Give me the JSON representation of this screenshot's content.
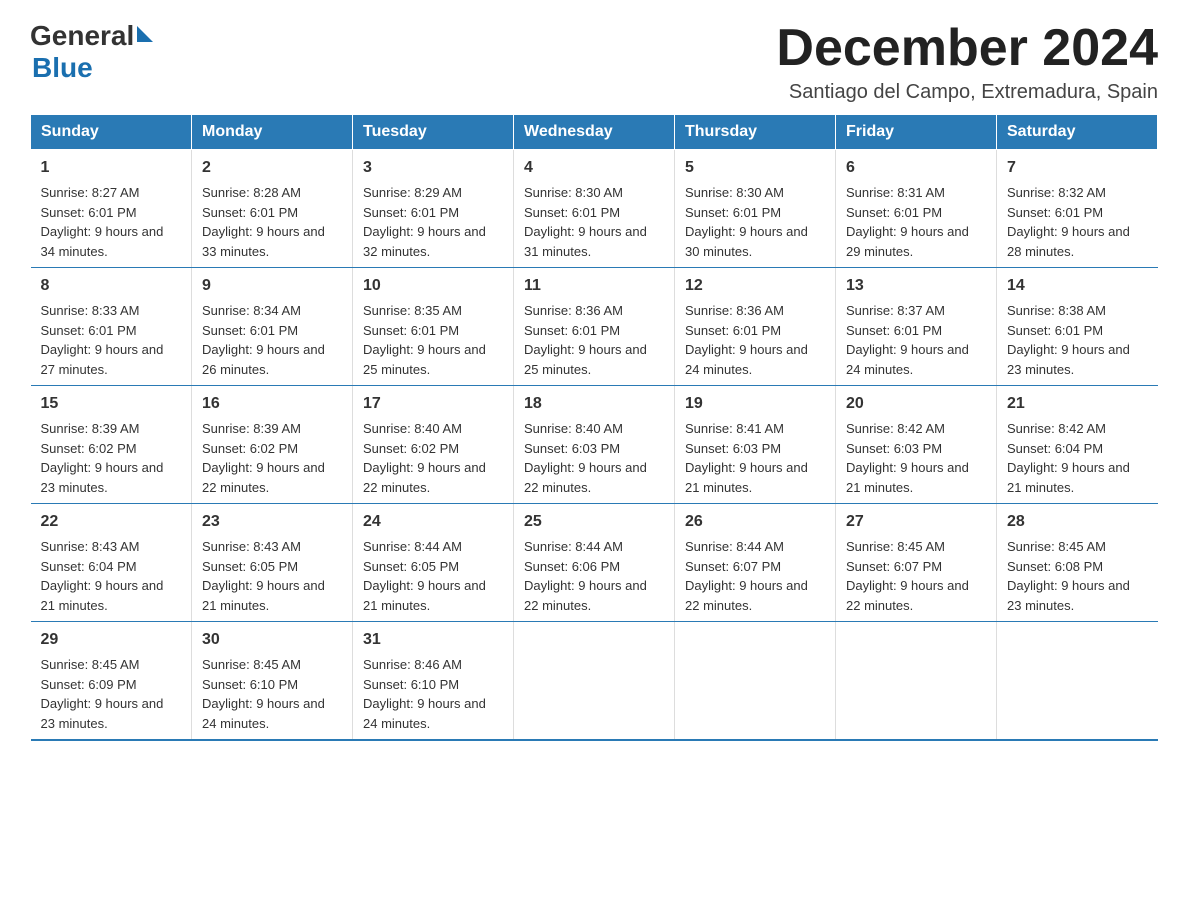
{
  "logo": {
    "general": "General",
    "blue": "Blue"
  },
  "header": {
    "title": "December 2024",
    "subtitle": "Santiago del Campo, Extremadura, Spain"
  },
  "calendar": {
    "days": [
      "Sunday",
      "Monday",
      "Tuesday",
      "Wednesday",
      "Thursday",
      "Friday",
      "Saturday"
    ],
    "weeks": [
      [
        {
          "date": "1",
          "sunrise": "8:27 AM",
          "sunset": "6:01 PM",
          "daylight": "9 hours and 34 minutes."
        },
        {
          "date": "2",
          "sunrise": "8:28 AM",
          "sunset": "6:01 PM",
          "daylight": "9 hours and 33 minutes."
        },
        {
          "date": "3",
          "sunrise": "8:29 AM",
          "sunset": "6:01 PM",
          "daylight": "9 hours and 32 minutes."
        },
        {
          "date": "4",
          "sunrise": "8:30 AM",
          "sunset": "6:01 PM",
          "daylight": "9 hours and 31 minutes."
        },
        {
          "date": "5",
          "sunrise": "8:30 AM",
          "sunset": "6:01 PM",
          "daylight": "9 hours and 30 minutes."
        },
        {
          "date": "6",
          "sunrise": "8:31 AM",
          "sunset": "6:01 PM",
          "daylight": "9 hours and 29 minutes."
        },
        {
          "date": "7",
          "sunrise": "8:32 AM",
          "sunset": "6:01 PM",
          "daylight": "9 hours and 28 minutes."
        }
      ],
      [
        {
          "date": "8",
          "sunrise": "8:33 AM",
          "sunset": "6:01 PM",
          "daylight": "9 hours and 27 minutes."
        },
        {
          "date": "9",
          "sunrise": "8:34 AM",
          "sunset": "6:01 PM",
          "daylight": "9 hours and 26 minutes."
        },
        {
          "date": "10",
          "sunrise": "8:35 AM",
          "sunset": "6:01 PM",
          "daylight": "9 hours and 25 minutes."
        },
        {
          "date": "11",
          "sunrise": "8:36 AM",
          "sunset": "6:01 PM",
          "daylight": "9 hours and 25 minutes."
        },
        {
          "date": "12",
          "sunrise": "8:36 AM",
          "sunset": "6:01 PM",
          "daylight": "9 hours and 24 minutes."
        },
        {
          "date": "13",
          "sunrise": "8:37 AM",
          "sunset": "6:01 PM",
          "daylight": "9 hours and 24 minutes."
        },
        {
          "date": "14",
          "sunrise": "8:38 AM",
          "sunset": "6:01 PM",
          "daylight": "9 hours and 23 minutes."
        }
      ],
      [
        {
          "date": "15",
          "sunrise": "8:39 AM",
          "sunset": "6:02 PM",
          "daylight": "9 hours and 23 minutes."
        },
        {
          "date": "16",
          "sunrise": "8:39 AM",
          "sunset": "6:02 PM",
          "daylight": "9 hours and 22 minutes."
        },
        {
          "date": "17",
          "sunrise": "8:40 AM",
          "sunset": "6:02 PM",
          "daylight": "9 hours and 22 minutes."
        },
        {
          "date": "18",
          "sunrise": "8:40 AM",
          "sunset": "6:03 PM",
          "daylight": "9 hours and 22 minutes."
        },
        {
          "date": "19",
          "sunrise": "8:41 AM",
          "sunset": "6:03 PM",
          "daylight": "9 hours and 21 minutes."
        },
        {
          "date": "20",
          "sunrise": "8:42 AM",
          "sunset": "6:03 PM",
          "daylight": "9 hours and 21 minutes."
        },
        {
          "date": "21",
          "sunrise": "8:42 AM",
          "sunset": "6:04 PM",
          "daylight": "9 hours and 21 minutes."
        }
      ],
      [
        {
          "date": "22",
          "sunrise": "8:43 AM",
          "sunset": "6:04 PM",
          "daylight": "9 hours and 21 minutes."
        },
        {
          "date": "23",
          "sunrise": "8:43 AM",
          "sunset": "6:05 PM",
          "daylight": "9 hours and 21 minutes."
        },
        {
          "date": "24",
          "sunrise": "8:44 AM",
          "sunset": "6:05 PM",
          "daylight": "9 hours and 21 minutes."
        },
        {
          "date": "25",
          "sunrise": "8:44 AM",
          "sunset": "6:06 PM",
          "daylight": "9 hours and 22 minutes."
        },
        {
          "date": "26",
          "sunrise": "8:44 AM",
          "sunset": "6:07 PM",
          "daylight": "9 hours and 22 minutes."
        },
        {
          "date": "27",
          "sunrise": "8:45 AM",
          "sunset": "6:07 PM",
          "daylight": "9 hours and 22 minutes."
        },
        {
          "date": "28",
          "sunrise": "8:45 AM",
          "sunset": "6:08 PM",
          "daylight": "9 hours and 23 minutes."
        }
      ],
      [
        {
          "date": "29",
          "sunrise": "8:45 AM",
          "sunset": "6:09 PM",
          "daylight": "9 hours and 23 minutes."
        },
        {
          "date": "30",
          "sunrise": "8:45 AM",
          "sunset": "6:10 PM",
          "daylight": "9 hours and 24 minutes."
        },
        {
          "date": "31",
          "sunrise": "8:46 AM",
          "sunset": "6:10 PM",
          "daylight": "9 hours and 24 minutes."
        },
        null,
        null,
        null,
        null
      ]
    ]
  }
}
